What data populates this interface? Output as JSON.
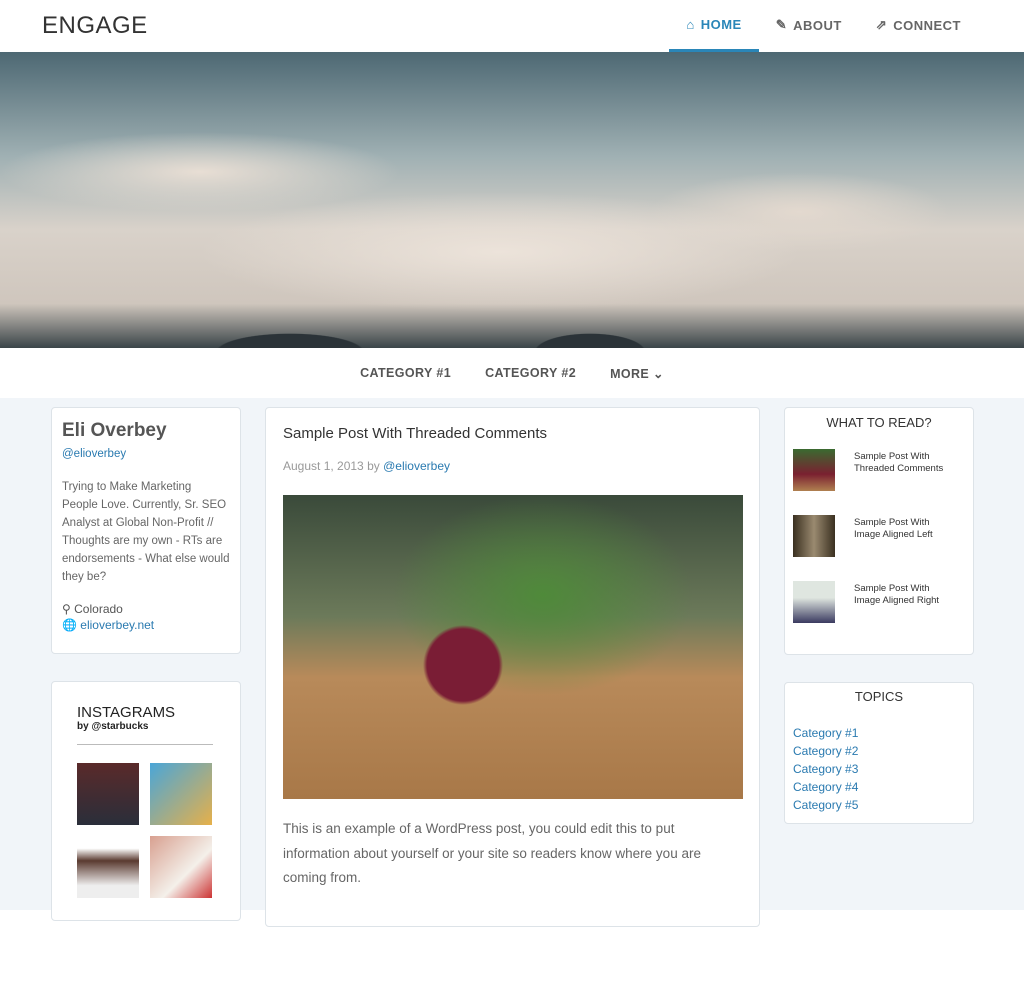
{
  "header": {
    "logo": "ENGAGE",
    "nav": [
      {
        "label": "HOME",
        "icon": "home-icon"
      },
      {
        "label": "ABOUT",
        "icon": "edit-icon"
      },
      {
        "label": "CONNECT",
        "icon": "share-icon"
      }
    ]
  },
  "subnav": {
    "items": [
      "CATEGORY #1",
      "CATEGORY #2",
      "MORE"
    ]
  },
  "profile": {
    "name": "Eli Overbey",
    "handle": "@elioverbey",
    "bio": "Trying to Make Marketing People Love. Currently, Sr. SEO Analyst at Global Non-Profit // Thoughts are my own - RTs are endorsements - What else would they be?",
    "location": "Colorado",
    "website": "elioverbey.net"
  },
  "instagram": {
    "title": "INSTAGRAMS",
    "subtitle": "by @starbucks"
  },
  "post": {
    "title": "Sample Post With Threaded Comments",
    "date": "August 1, 2013",
    "by": "by",
    "author": "@elioverbey",
    "body": "This is an example of a WordPress post, you could edit this to put information about yourself or your site so readers know where you are coming from."
  },
  "what_to_read": {
    "title": "WHAT TO READ?",
    "items": [
      {
        "line1": "Sample Post With",
        "line2": "Threaded Comments"
      },
      {
        "line1": "Sample Post With",
        "line2": "Image Aligned Left"
      },
      {
        "line1": "Sample Post With",
        "line2": "Image Aligned Right"
      }
    ]
  },
  "topics": {
    "title": "TOPICS",
    "items": [
      "Category #1",
      "Category #2",
      "Category #3",
      "Category #4",
      "Category #5"
    ]
  },
  "colors": {
    "accent": "#2a86b8",
    "background": "#f1f5f9"
  }
}
